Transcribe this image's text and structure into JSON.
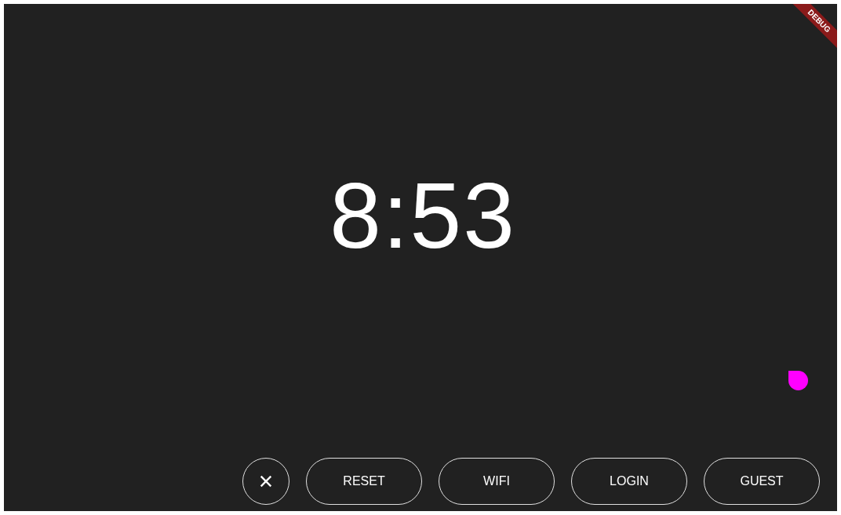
{
  "debug_banner": {
    "label": "DEBUG"
  },
  "clock": {
    "time": "8:53"
  },
  "buttons": [
    {
      "kind": "close"
    },
    {
      "kind": "text",
      "label": "RESET"
    },
    {
      "kind": "text",
      "label": "WIFI"
    },
    {
      "kind": "text",
      "label": "LOGIN"
    },
    {
      "kind": "text",
      "label": "GUEST"
    }
  ]
}
